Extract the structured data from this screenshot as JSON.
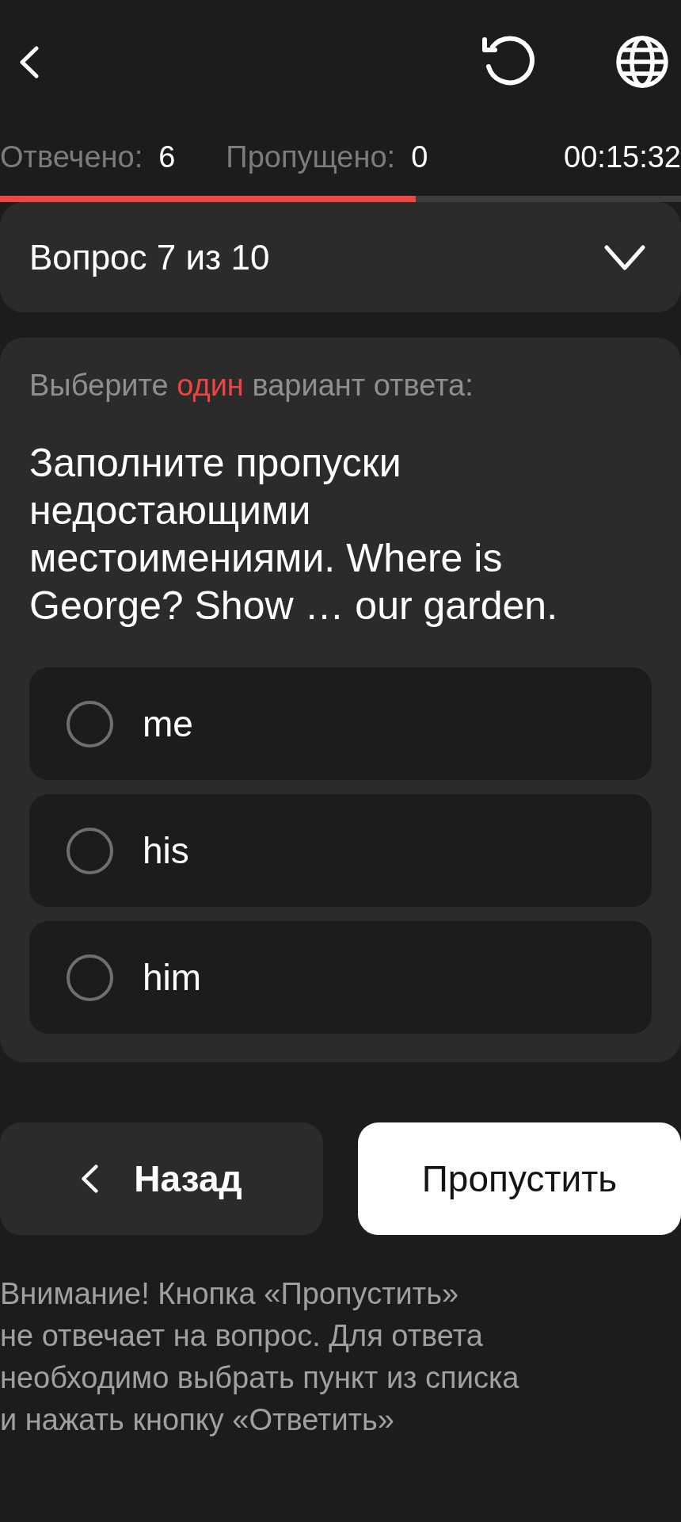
{
  "stats": [
    {
      "label": "Отвечено:",
      "value": "6"
    },
    {
      "label": "Пропущено:",
      "value": "0"
    }
  ],
  "timer": "00:15:32",
  "progress": {
    "level": 0.61
  },
  "question_header": {
    "title": "Вопрос 7 из 10",
    "expanded": false
  },
  "question": {
    "instruction": {
      "before": "Выберите",
      "highlight": "один",
      "after": "вариант ответа:"
    },
    "text": "Заполните пропуски недостающими местоимениями. Where is George? Show … our garden.",
    "options": [
      {
        "label": "me",
        "selected": false
      },
      {
        "label": "his",
        "selected": false
      },
      {
        "label": "him",
        "selected": false
      }
    ]
  },
  "buttons": [
    {
      "kind": "back",
      "label": "Назад"
    },
    {
      "kind": "skip",
      "label": "Пропустить"
    }
  ],
  "note": "Внимание! Кнопка «Пропустить»\nне отвечает на вопрос. Для ответа\nнеобходимо выбрать пункт из списка\nи нажать кнопку «Ответить»"
}
